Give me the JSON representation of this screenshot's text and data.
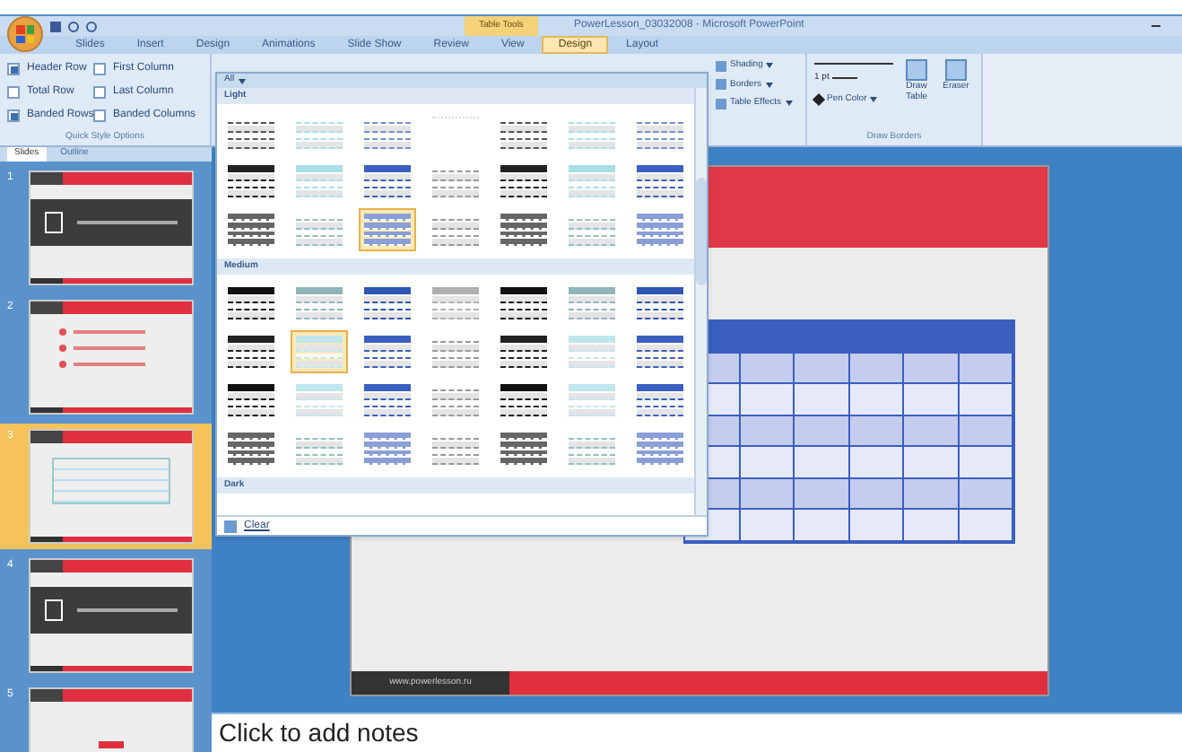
{
  "window": {
    "title": "PowerLesson_03032008 - Microsoft PowerPoint",
    "context_tab": "Table Tools"
  },
  "tabs": [
    {
      "label": "Slides",
      "selected": false
    },
    {
      "label": "Insert",
      "selected": false
    },
    {
      "label": "Design",
      "selected": false
    },
    {
      "label": "Animations",
      "selected": false
    },
    {
      "label": "Slide Show",
      "selected": false
    },
    {
      "label": "Review",
      "selected": false
    },
    {
      "label": "View",
      "selected": false
    },
    {
      "label": "Design",
      "selected": true
    },
    {
      "label": "Layout",
      "selected": false
    }
  ],
  "quick_style_options": {
    "label": "Quick Style Options",
    "options": [
      {
        "label": "Header Row",
        "checked": true
      },
      {
        "label": "First Column",
        "checked": false
      },
      {
        "label": "Total Row",
        "checked": false
      },
      {
        "label": "Last Column",
        "checked": false
      },
      {
        "label": "Banded Rows",
        "checked": true
      },
      {
        "label": "Banded Columns",
        "checked": false
      }
    ]
  },
  "table_styles": {
    "filter": "All",
    "sections": [
      {
        "label": "Light",
        "rows": [
          [
            {
              "kind": "lines",
              "color": "#555555",
              "selected": false
            },
            {
              "kind": "lines",
              "color": "#a8dfe6",
              "selected": false
            },
            {
              "kind": "lines",
              "color": "#6f8fd8",
              "selected": false
            },
            {
              "kind": "empty",
              "color": "#dddddd",
              "selected": false
            },
            {
              "kind": "lines",
              "color": "#555555",
              "selected": false
            },
            {
              "kind": "lines",
              "color": "#a8dfe6",
              "selected": false
            },
            {
              "kind": "lines",
              "color": "#6f8fd8",
              "selected": false
            }
          ],
          [
            {
              "kind": "header",
              "color": "#222222",
              "selected": false
            },
            {
              "kind": "header",
              "color": "#a8dfe6",
              "selected": false
            },
            {
              "kind": "header",
              "color": "#3a5fc0",
              "selected": false
            },
            {
              "kind": "plain",
              "color": "#999999",
              "selected": false
            },
            {
              "kind": "header",
              "color": "#222222",
              "selected": false
            },
            {
              "kind": "header",
              "color": "#a8dfe6",
              "selected": false
            },
            {
              "kind": "header",
              "color": "#3a5fc0",
              "selected": false
            }
          ],
          [
            {
              "kind": "grid",
              "color": "#666666",
              "selected": false
            },
            {
              "kind": "plain",
              "color": "#8fbfc6",
              "selected": false
            },
            {
              "kind": "grid",
              "color": "#8a9fd8",
              "selected": true
            },
            {
              "kind": "plain",
              "color": "#999999",
              "selected": false
            },
            {
              "kind": "grid",
              "color": "#666666",
              "selected": false
            },
            {
              "kind": "plain",
              "color": "#8fbfc6",
              "selected": false
            },
            {
              "kind": "grid",
              "color": "#8a9fd8",
              "selected": false
            }
          ]
        ]
      },
      {
        "label": "Medium",
        "rows": [
          [
            {
              "kind": "header",
              "color": "#111111",
              "selected": false
            },
            {
              "kind": "header",
              "color": "#8fb5b8",
              "selected": false
            },
            {
              "kind": "header",
              "color": "#2f55b5",
              "selected": false
            },
            {
              "kind": "header",
              "color": "#b0b0b0",
              "selected": false
            },
            {
              "kind": "header",
              "color": "#111111",
              "selected": false
            },
            {
              "kind": "header",
              "color": "#8fb5b8",
              "selected": false
            },
            {
              "kind": "header",
              "color": "#2f55b5",
              "selected": false
            }
          ],
          [
            {
              "kind": "header",
              "color": "#222222",
              "selected": false
            },
            {
              "kind": "header",
              "color": "#bfe6ec",
              "selected": true
            },
            {
              "kind": "header",
              "color": "#3a5fc0",
              "selected": false
            },
            {
              "kind": "plain",
              "color": "#999999",
              "selected": false
            },
            {
              "kind": "header",
              "color": "#222222",
              "selected": false
            },
            {
              "kind": "header",
              "color": "#bfe6ec",
              "selected": false
            },
            {
              "kind": "header",
              "color": "#3a5fc0",
              "selected": false
            }
          ],
          [
            {
              "kind": "header",
              "color": "#111111",
              "selected": false
            },
            {
              "kind": "header",
              "color": "#bfe6ec",
              "selected": false
            },
            {
              "kind": "header",
              "color": "#3a5fc0",
              "selected": false
            },
            {
              "kind": "plain",
              "color": "#999999",
              "selected": false
            },
            {
              "kind": "header",
              "color": "#111111",
              "selected": false
            },
            {
              "kind": "header",
              "color": "#bfe6ec",
              "selected": false
            },
            {
              "kind": "header",
              "color": "#3a5fc0",
              "selected": false
            }
          ],
          [
            {
              "kind": "grid",
              "color": "#666666",
              "selected": false
            },
            {
              "kind": "plain",
              "color": "#8fbfc6",
              "selected": false
            },
            {
              "kind": "grid",
              "color": "#8a9fd8",
              "selected": false
            },
            {
              "kind": "plain",
              "color": "#999999",
              "selected": false
            },
            {
              "kind": "grid",
              "color": "#666666",
              "selected": false
            },
            {
              "kind": "plain",
              "color": "#8fbfc6",
              "selected": false
            },
            {
              "kind": "grid",
              "color": "#8a9fd8",
              "selected": false
            }
          ]
        ]
      },
      {
        "label": "Dark"
      }
    ],
    "clear": "Clear"
  },
  "table_style_buttons": [
    "Shading",
    "Borders",
    "Table Effects"
  ],
  "draw_borders": {
    "label": "Draw Borders",
    "pen_weight": "1 pt",
    "pen_color": "Pen Color",
    "draw_table": "Draw Table",
    "eraser": "Eraser"
  },
  "pane_tabs": [
    {
      "label": "Slides",
      "selected": true
    },
    {
      "label": "Outline",
      "selected": false
    }
  ],
  "slides": [
    {
      "number": "1",
      "kind": "title",
      "selected": false
    },
    {
      "number": "2",
      "kind": "bullets",
      "selected": false
    },
    {
      "number": "3",
      "kind": "table",
      "selected": true
    },
    {
      "number": "4",
      "kind": "question",
      "selected": false
    },
    {
      "number": "5",
      "kind": "diagram",
      "selected": false
    }
  ],
  "slide": {
    "footer": "www.powerlesson.ru"
  },
  "notes": {
    "placeholder": "Click to add notes"
  }
}
